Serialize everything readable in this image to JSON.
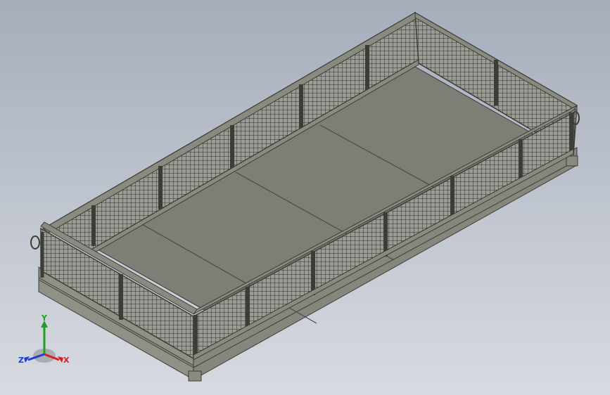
{
  "viewport": {
    "background_top": "#a6adbb",
    "background_bottom": "#d7dae1"
  },
  "model": {
    "type": "mesh-sided cargo basket",
    "floor_color": "#7d7e76",
    "frame_color": "#8a8b80",
    "frame_edge_color": "#3c3d37",
    "mesh_color": "#2f302c"
  },
  "triad": {
    "x_label": "X",
    "y_label": "Y",
    "z_label": "Z",
    "x_color": "#d62020",
    "y_color": "#20a020",
    "z_color": "#2040d0"
  }
}
